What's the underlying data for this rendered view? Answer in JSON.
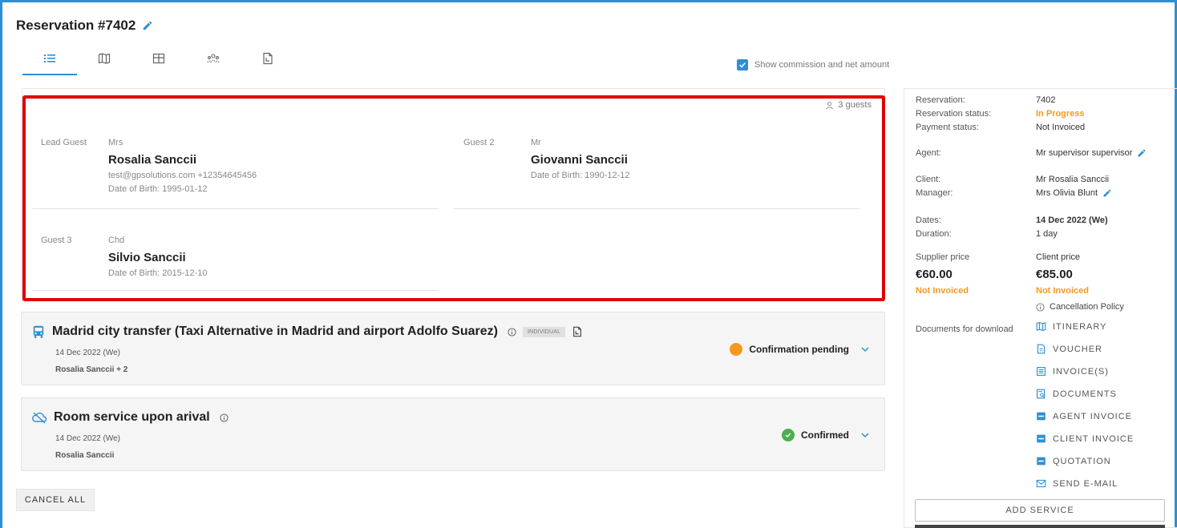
{
  "header": {
    "title": "Reservation #7402"
  },
  "tabs": [
    {
      "name": "tab-list",
      "icon": "list-icon"
    },
    {
      "name": "tab-map",
      "icon": "map-icon"
    },
    {
      "name": "tab-table",
      "icon": "table-icon"
    },
    {
      "name": "tab-guests",
      "icon": "group-icon"
    },
    {
      "name": "tab-documents",
      "icon": "copy-icon"
    }
  ],
  "commission": {
    "label": "Show commission and net amount",
    "checked": true
  },
  "guests": {
    "count_label": "3 guests",
    "list": [
      {
        "role": "Lead Guest",
        "title": "Mrs",
        "name": "Rosalia Sanccii",
        "contact": "test@gpsolutions.com +12354645456",
        "dob": "Date of Birth: 1995-01-12"
      },
      {
        "role": "Guest 2",
        "title": "Mr",
        "name": "Giovanni Sanccii",
        "contact": "",
        "dob": "Date of Birth: 1990-12-12"
      },
      {
        "role": "Guest 3",
        "title": "Chd",
        "name": "Silvio Sanccii",
        "contact": "",
        "dob": "Date of Birth: 2015-12-10"
      }
    ]
  },
  "services": [
    {
      "name": "Madrid city transfer (Taxi Alternative in Madrid and airport Adolfo Suarez)",
      "badge": "INDIVIDUAL",
      "date": "14 Dec 2022 (We)",
      "guests": "Rosalia Sanccii + 2",
      "status": "Confirmation pending",
      "status_color": "#f39a1e",
      "icon": "bus-icon"
    },
    {
      "name": "Room service upon arival",
      "badge": "",
      "date": "14 Dec 2022 (We)",
      "guests": "Rosalia Sanccii",
      "status": "Confirmed",
      "status_color": "#4caf50",
      "icon": "cloud-off-icon"
    }
  ],
  "actions": {
    "cancel_all": "CANCEL ALL",
    "add_service": "ADD SERVICE"
  },
  "summary": {
    "reservation_label": "Reservation:",
    "reservation_value": "7402",
    "status_label": "Reservation status:",
    "status_value": "In Progress",
    "payment_label": "Payment status:",
    "payment_value": "Not Invoiced",
    "agent_label": "Agent:",
    "agent_value": "Mr supervisor supervisor",
    "client_label": "Client:",
    "client_value": "Mr Rosalia Sanccii",
    "manager_label": "Manager:",
    "manager_value": "Mrs Olivia Blunt",
    "dates_label": "Dates:",
    "dates_value": "14 Dec 2022 (We)",
    "duration_label": "Duration:",
    "duration_value": "1 day",
    "supplier_price_label": "Supplier price",
    "supplier_price_value": "€60.00",
    "supplier_invoice": "Not Invoiced",
    "client_price_label": "Client price",
    "client_price_value": "€85.00",
    "client_invoice": "Not Invoiced",
    "cancellation": "Cancellation Policy",
    "documents_label": "Documents for download",
    "documents": [
      "ITINERARY",
      "VOUCHER",
      "INVOICE(S)",
      "DOCUMENTS",
      "AGENT INVOICE",
      "CLIENT INVOICE",
      "QUOTATION",
      "SEND E-MAIL"
    ]
  },
  "colors": {
    "accent": "#2d8fd5",
    "orange": "#f39a1e",
    "green": "#4caf50",
    "highlight": "#e00000"
  }
}
